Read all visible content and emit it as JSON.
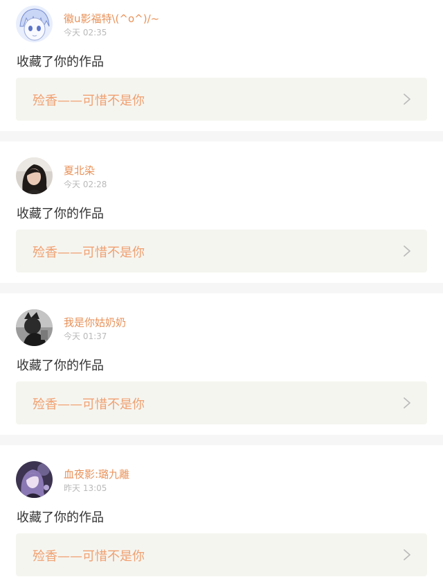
{
  "colors": {
    "username": "#e8925a",
    "timestamp": "#b9b9b9",
    "action": "#333333",
    "work_title": "#f0a070",
    "work_box_bg": "#f5f5f0",
    "separator": "#f6f6f6",
    "chevron": "#bbbbbb"
  },
  "notifications": [
    {
      "username": "徽u影福特\\(^o^)/~",
      "time": "今天 02:35",
      "action": "收藏了你的作品",
      "work_title": "殓香——可惜不是你",
      "avatar_icon": "anime-boy-avatar",
      "chevron_icon": "chevron-right-icon"
    },
    {
      "username": "夏北染",
      "time": "今天 02:28",
      "action": "收藏了你的作品",
      "work_title": "殓香——可惜不是你",
      "avatar_icon": "girl-photo-avatar",
      "chevron_icon": "chevron-right-icon"
    },
    {
      "username": "我是你姑奶奶",
      "time": "今天 01:37",
      "action": "收藏了你的作品",
      "work_title": "殓香——可惜不是你",
      "avatar_icon": "bw-portrait-avatar",
      "chevron_icon": "chevron-right-icon"
    },
    {
      "username": "血夜影:璐九離",
      "time": "昨天 13:05",
      "action": "收藏了你的作品",
      "work_title": "殓香——可惜不是你",
      "avatar_icon": "purple-anime-avatar",
      "chevron_icon": "chevron-right-icon"
    }
  ]
}
